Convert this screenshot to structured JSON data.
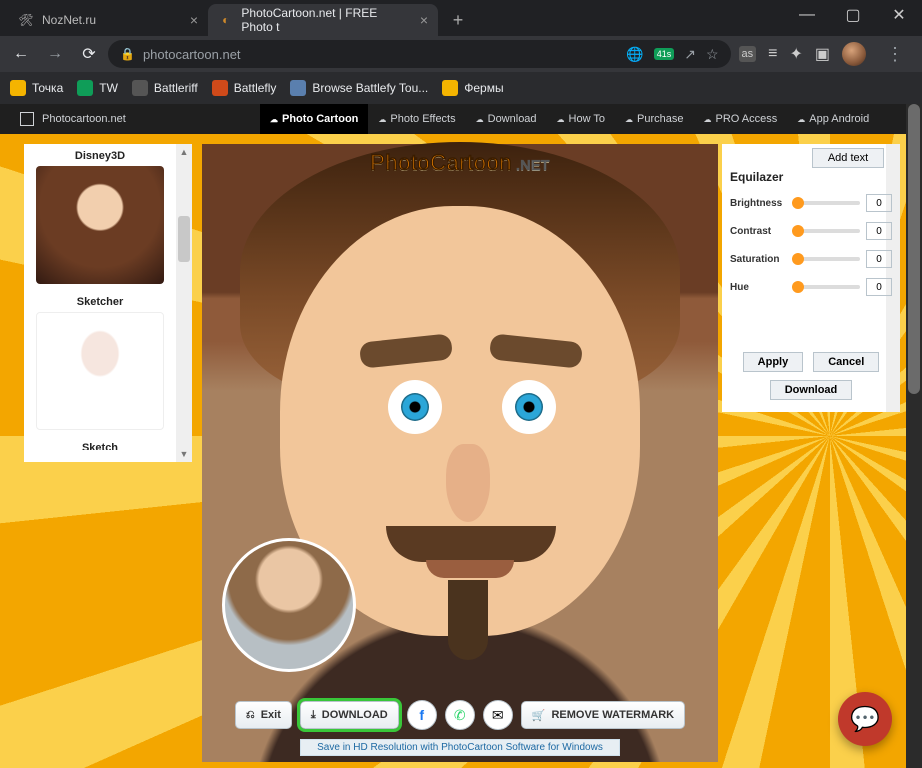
{
  "browser": {
    "tabs": [
      {
        "title": "NozNet.ru"
      },
      {
        "title": "PhotoCartoon.net | FREE Photo t"
      }
    ],
    "url": "photocartoon.net",
    "omni_hint_badge": "41s",
    "bookmarks": [
      {
        "label": "Точка",
        "color": "#f4b400"
      },
      {
        "label": "TW",
        "color": "#0f9d58"
      },
      {
        "label": "Battleriff",
        "color": "#888"
      },
      {
        "label": "Battlefly",
        "color": "#cf4a1a"
      },
      {
        "label": "Browse Battlefy Tou...",
        "color": "#5a7fae"
      },
      {
        "label": "Фермы",
        "color": "#f4b400"
      }
    ]
  },
  "site": {
    "brand": "Photocartoon.net",
    "nav": [
      {
        "label": "Photo Cartoon",
        "active": true
      },
      {
        "label": "Photo Effects"
      },
      {
        "label": "Download"
      },
      {
        "label": "How To"
      },
      {
        "label": "Purchase"
      },
      {
        "label": "PRO Access"
      },
      {
        "label": "App Android"
      }
    ]
  },
  "filters": {
    "items": [
      {
        "name": "Disney3D"
      },
      {
        "name": "Sketcher"
      },
      {
        "name": "Sketch"
      }
    ]
  },
  "canvas": {
    "watermark_a": "PhotoCartoon",
    "watermark_b": ".NET",
    "exit_label": "Exit",
    "download_label": "DOWNLOAD",
    "remove_wm_label": "REMOVE WATERMARK",
    "hd_line": "Save in HD Resolution with PhotoCartoon Software for Windows"
  },
  "equalizer": {
    "addtext_label": "Add text",
    "title": "Equilazer",
    "sliders": [
      {
        "label": "Brightness",
        "value": "0"
      },
      {
        "label": "Contrast",
        "value": "0"
      },
      {
        "label": "Saturation",
        "value": "0"
      },
      {
        "label": "Hue",
        "value": "0"
      }
    ],
    "apply_label": "Apply",
    "cancel_label": "Cancel",
    "download_label": "Download"
  }
}
